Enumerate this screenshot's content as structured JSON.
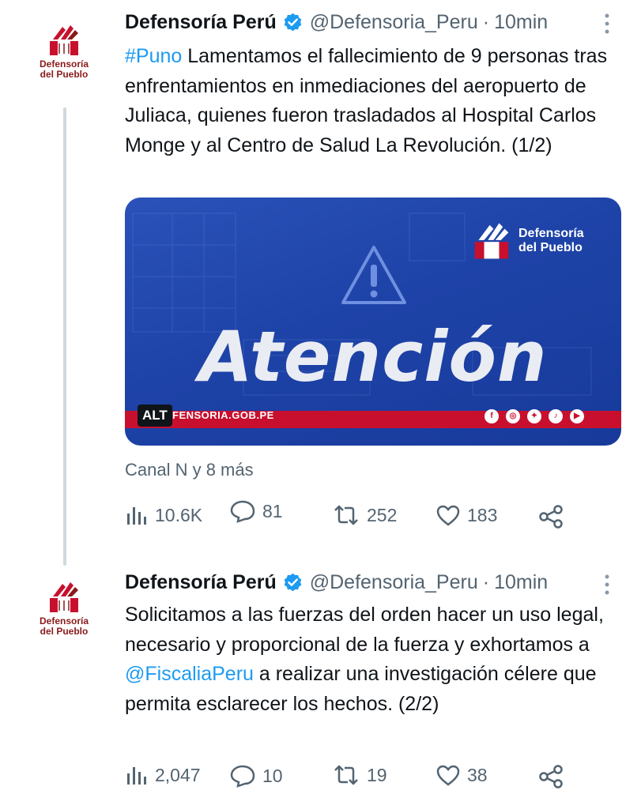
{
  "tweets": [
    {
      "author_name": "Defensoría Perú",
      "handle": "@Defensoria_Peru",
      "separator": "·",
      "time": "10min",
      "hashtag": "#Puno",
      "text": " Lamentamos el fallecimiento de 9 personas tras enfrentamientos en inmediaciones del aeropuerto de Juliaca, quienes fueron trasladados al Hospital Carlos Monge y al Centro de Salud La Revolución. (1/2)",
      "avatar_text_1": "Defensoría",
      "avatar_text_2": "del Pueblo",
      "media": {
        "headline": "Atención",
        "logo_line_1": "Defensoría",
        "logo_line_2": "del Pueblo",
        "alt_badge": "ALT",
        "site": "FENSORIA.GOB.PE"
      },
      "context": "Canal N y 8 más",
      "stats": {
        "views": "10.6K",
        "replies": "81",
        "retweets": "252",
        "likes": "183"
      }
    },
    {
      "author_name": "Defensoría Perú",
      "handle": "@Defensoria_Peru",
      "separator": "·",
      "time": "10min",
      "text_before": "Solicitamos a las fuerzas del orden hacer un uso legal, necesario y proporcional de la fuerza y exhortamos a ",
      "mention": "@FiscaliaPeru",
      "text_after": " a realizar una investigación célere que permita esclarecer los hechos. (2/2)",
      "avatar_text_1": "Defensoría",
      "avatar_text_2": "del Pueblo",
      "stats": {
        "views": "2,047",
        "replies": "10",
        "retweets": "19",
        "likes": "38"
      }
    }
  ],
  "colors": {
    "link": "#1d9bf0",
    "muted": "#536471",
    "brand_red": "#c8102e",
    "media_blue": "#1e43a8"
  }
}
